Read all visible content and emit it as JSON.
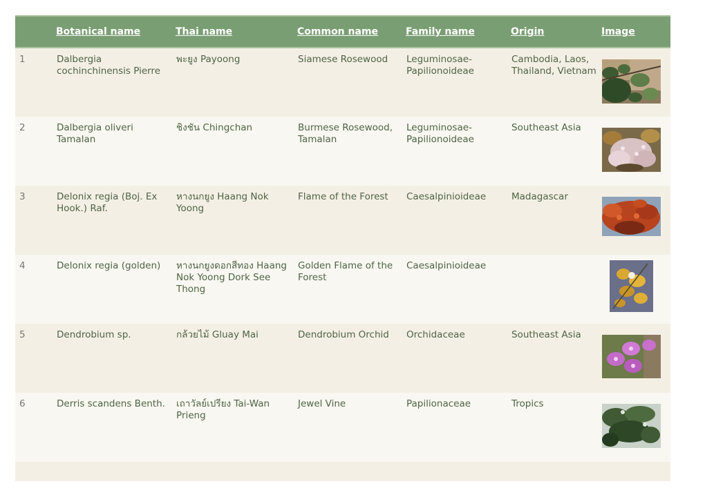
{
  "headers": {
    "num": "",
    "botanical": "Botanical name",
    "thai": "Thai name",
    "common": "Common name",
    "family": "Family name",
    "origin": "Origin",
    "image": "Image"
  },
  "rows": [
    {
      "num": "1",
      "botanical": "Dalbergia cochinchinensis Pierre",
      "thai": "พะยูง Payoong",
      "common": "Siamese Rosewood",
      "family": "Leguminosae-Papilionoideae",
      "origin": "Cambodia, Laos, Thailand, Vietnam",
      "image_icon": "leafy-branch-photo"
    },
    {
      "num": "2",
      "botanical": "Dalbergia oliveri Tamalan",
      "thai": "ชิงชัน Chingchan",
      "common": "Burmese Rosewood, Tamalan",
      "family": "Leguminosae-Papilionoideae",
      "origin": "Southeast Asia",
      "image_icon": "pink-blossom-photo"
    },
    {
      "num": "3",
      "botanical": "Delonix regia (Boj. Ex Hook.) Raf.",
      "thai": "หางนกยูง Haang Nok Yoong",
      "common": "Flame of the Forest",
      "family": "Caesalpinioideae",
      "origin": "Madagascar",
      "image_icon": "red-flame-tree-photo"
    },
    {
      "num": "4",
      "botanical": "Delonix regia (golden)",
      "thai": "หางนกยูงดอกสีทอง Haang Nok Yoong Dork See Thong",
      "common": "Golden Flame of the Forest",
      "family": "Caesalpinioideae",
      "origin": "",
      "image_icon": "golden-flower-photo"
    },
    {
      "num": "5",
      "botanical": "Dendrobium sp.",
      "thai": "กล้วยไม้ Gluay Mai",
      "common": "Dendrobium Orchid",
      "family": "Orchidaceae",
      "origin": "Southeast Asia",
      "image_icon": "purple-orchid-photo"
    },
    {
      "num": "6",
      "botanical": "Derris scandens Benth.",
      "thai": "เถาวัลย์เปรียง Tai-Wan Prieng",
      "common": "Jewel Vine",
      "family": "Papilionaceae",
      "origin": "Tropics",
      "image_icon": "green-vine-photo"
    }
  ]
}
